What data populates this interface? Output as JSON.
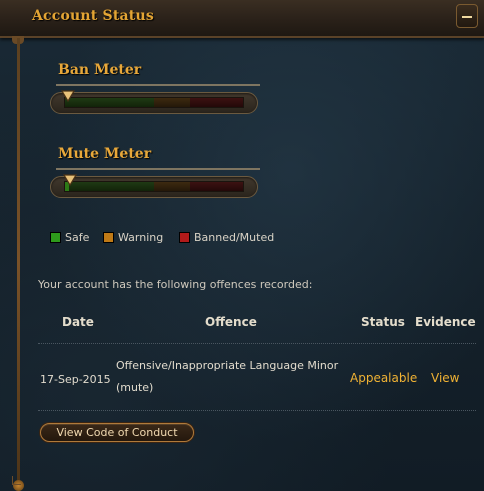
{
  "window": {
    "title": "Account Status"
  },
  "meters": [
    {
      "label": "Ban Meter",
      "level": 0.0
    },
    {
      "label": "Mute Meter",
      "level": 0.02
    }
  ],
  "legend": [
    {
      "label": "Safe",
      "color": "#2e9b1c"
    },
    {
      "label": "Warning",
      "color": "#c07a16"
    },
    {
      "label": "Banned/Muted",
      "color": "#b11a1a"
    }
  ],
  "offences": {
    "intro": "Your account has the following offences recorded:",
    "columns": [
      "Date",
      "Offence",
      "Status",
      "Evidence"
    ],
    "rows": [
      {
        "date": "17-Sep-2015",
        "offence_line1": "Offensive/Inappropriate Language Minor",
        "offence_line2": "(mute)",
        "status": "Appealable",
        "evidence": "View"
      }
    ]
  },
  "code_of_conduct_button": "View Code of Conduct",
  "colors": {
    "accent": "#e4a534",
    "link": "#f0b234"
  },
  "icons": {
    "collapse": "minus-icon",
    "marker": "triangle-down-icon"
  }
}
